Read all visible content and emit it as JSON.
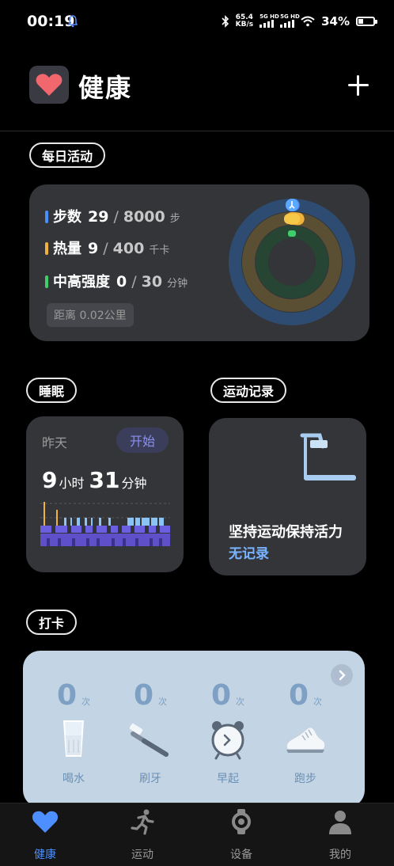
{
  "status_bar": {
    "time": "00:19",
    "speed_value": "65.4",
    "speed_unit": "KB/s",
    "sim1": "5G HD",
    "sim2": "5G HD",
    "battery": "34%",
    "battery_level": 0.34
  },
  "header": {
    "title": "健康"
  },
  "daily_activity": {
    "label": "每日活动",
    "rows": [
      {
        "name": "步数",
        "value": "29",
        "goal": "8000",
        "unit": "步",
        "color": "#4a8fff",
        "progress": 0.0036
      },
      {
        "name": "热量",
        "value": "9",
        "goal": "400",
        "unit": "千卡",
        "color": "#f0b23a",
        "progress": 0.0225
      },
      {
        "name": "中高强度",
        "value": "0",
        "goal": "30",
        "unit": "分钟",
        "color": "#3fce6a",
        "progress": 0
      }
    ],
    "slash": "/",
    "distance": "距离  0.02公里"
  },
  "sleep": {
    "section_label": "睡眠",
    "day": "昨天",
    "start_button": "开始",
    "hours": "9",
    "hours_unit": "小时",
    "minutes": "31",
    "minutes_unit": "分钟"
  },
  "exercise": {
    "section_label": "运动记录",
    "title": "坚持运动保持活力",
    "status": "无记录"
  },
  "checkin": {
    "section_label": "打卡",
    "items": [
      {
        "count": "0",
        "unit": "次",
        "label": "喝水",
        "icon": "water-glass-icon"
      },
      {
        "count": "0",
        "unit": "次",
        "label": "刷牙",
        "icon": "toothbrush-icon"
      },
      {
        "count": "0",
        "unit": "次",
        "label": "早起",
        "icon": "alarm-clock-icon"
      },
      {
        "count": "0",
        "unit": "次",
        "label": "跑步",
        "icon": "running-shoe-icon"
      }
    ]
  },
  "bottom_nav": {
    "items": [
      {
        "label": "健康",
        "icon": "heart-icon",
        "active": true
      },
      {
        "label": "运动",
        "icon": "runner-icon",
        "active": false
      },
      {
        "label": "设备",
        "icon": "watch-icon",
        "active": false
      },
      {
        "label": "我的",
        "icon": "profile-icon",
        "active": false
      }
    ]
  },
  "colors": {
    "accent": "#4d8fff",
    "steps": "#4a8fff",
    "calories": "#f0b23a",
    "intensity": "#3fce6a",
    "sleep_start_text": "#8a8ff0"
  }
}
